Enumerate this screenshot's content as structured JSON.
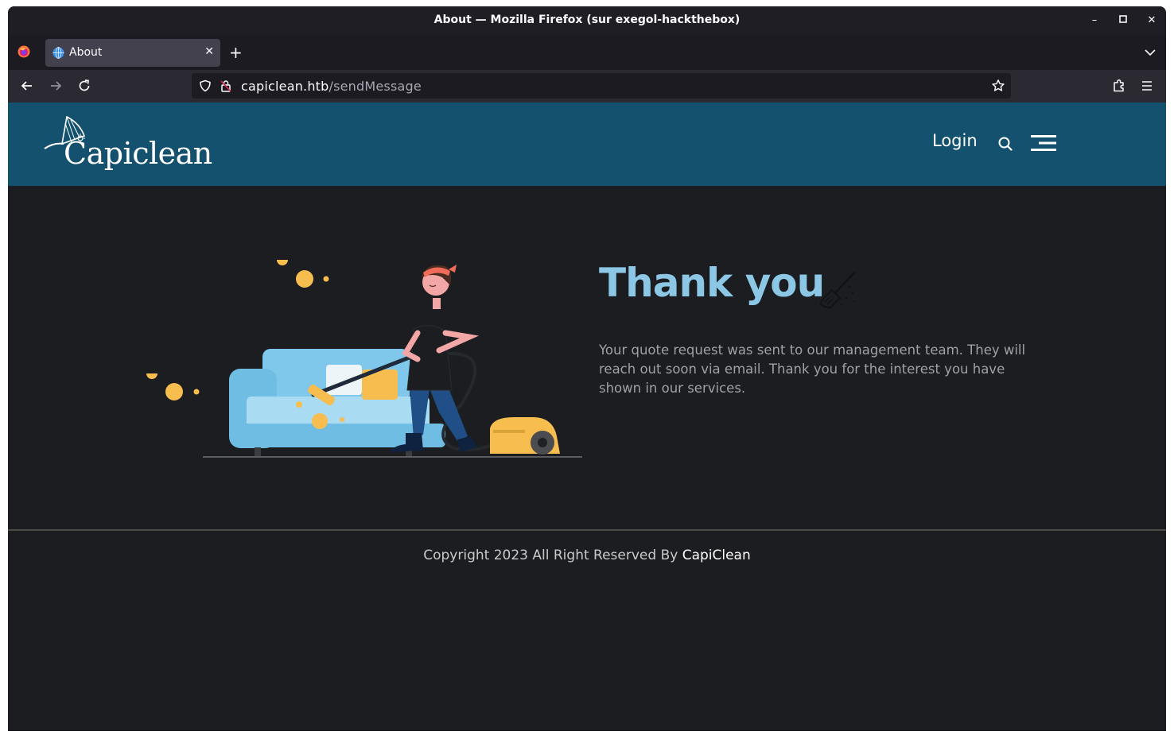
{
  "window": {
    "title": "About — Mozilla Firefox (sur exegol-hackthebox)",
    "minimize": "–",
    "maximize": "▫",
    "close": "✕"
  },
  "tabs": [
    {
      "label": "About",
      "close": "✕"
    }
  ],
  "toolbar": {
    "new_tab": "+",
    "url_host": "capiclean.htb",
    "url_path": "/sendMessage"
  },
  "site": {
    "logo_text": "Capiclean",
    "login": "Login",
    "heading": "Thank you",
    "message": "Your quote request was sent to our management team. They will reach out soon via email. Thank you for the interest you have shown in our services.",
    "footer_prefix": "Copyright 2023 All Right Reserved By ",
    "footer_brand": "CapiClean"
  },
  "colors": {
    "header_bg": "#13516e",
    "heading": "#8cc8e6",
    "page_bg": "#1c1d20"
  }
}
